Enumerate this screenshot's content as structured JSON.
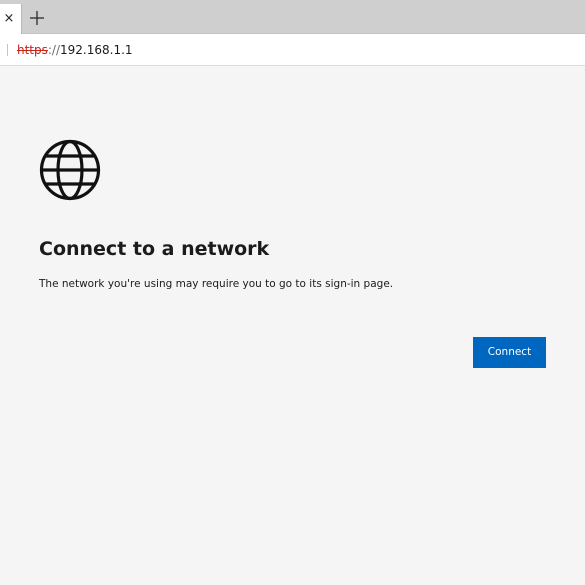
{
  "tab_strip": {
    "close_glyph": "×",
    "new_tab_glyph": "+"
  },
  "address_bar": {
    "scheme": "https",
    "separator": "://",
    "host": "192.168.1.1"
  },
  "page": {
    "icon": "globe-icon",
    "heading": "Connect to a network",
    "description": "The network you're using may require you to go to its sign-in page.",
    "connect_label": "Connect"
  },
  "colors": {
    "background": "#f5f5f5",
    "button": "#0067c0",
    "insecure_scheme": "#c8221b"
  }
}
